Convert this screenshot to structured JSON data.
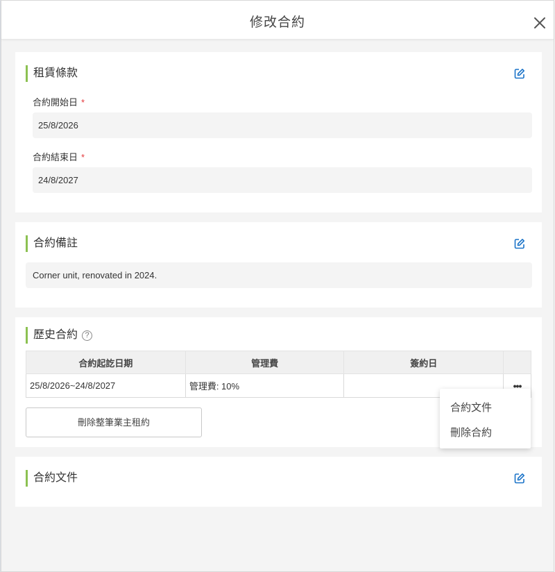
{
  "modal": {
    "title": "修改合約"
  },
  "lease_terms": {
    "heading": "租賃條款",
    "start_label": "合約開始日",
    "start_value": "25/8/2026",
    "end_label": "合約結束日",
    "end_value": "24/8/2027",
    "required_mark": "*"
  },
  "notes": {
    "heading": "合約備註",
    "text": "Corner unit, renovated in 2024."
  },
  "history": {
    "heading": "歷史合約",
    "help": "?",
    "columns": [
      "合約起訖日期",
      "管理費",
      "簽約日",
      ""
    ],
    "rows": [
      {
        "period": "25/8/2026~24/8/2027",
        "fee": "管理費: 10%",
        "signed": "",
        "more": "•••"
      }
    ],
    "delete_all_label": "刪除整筆業主租約"
  },
  "row_menu": {
    "items": [
      "合約文件",
      "刪除合約"
    ]
  },
  "documents": {
    "heading": "合約文件"
  },
  "colors": {
    "accent": "#8cc152",
    "edit_icon": "#1a73c8",
    "required": "#e4393c"
  },
  "icons": {
    "close": "close-icon",
    "edit": "edit-icon",
    "help": "help-icon"
  }
}
